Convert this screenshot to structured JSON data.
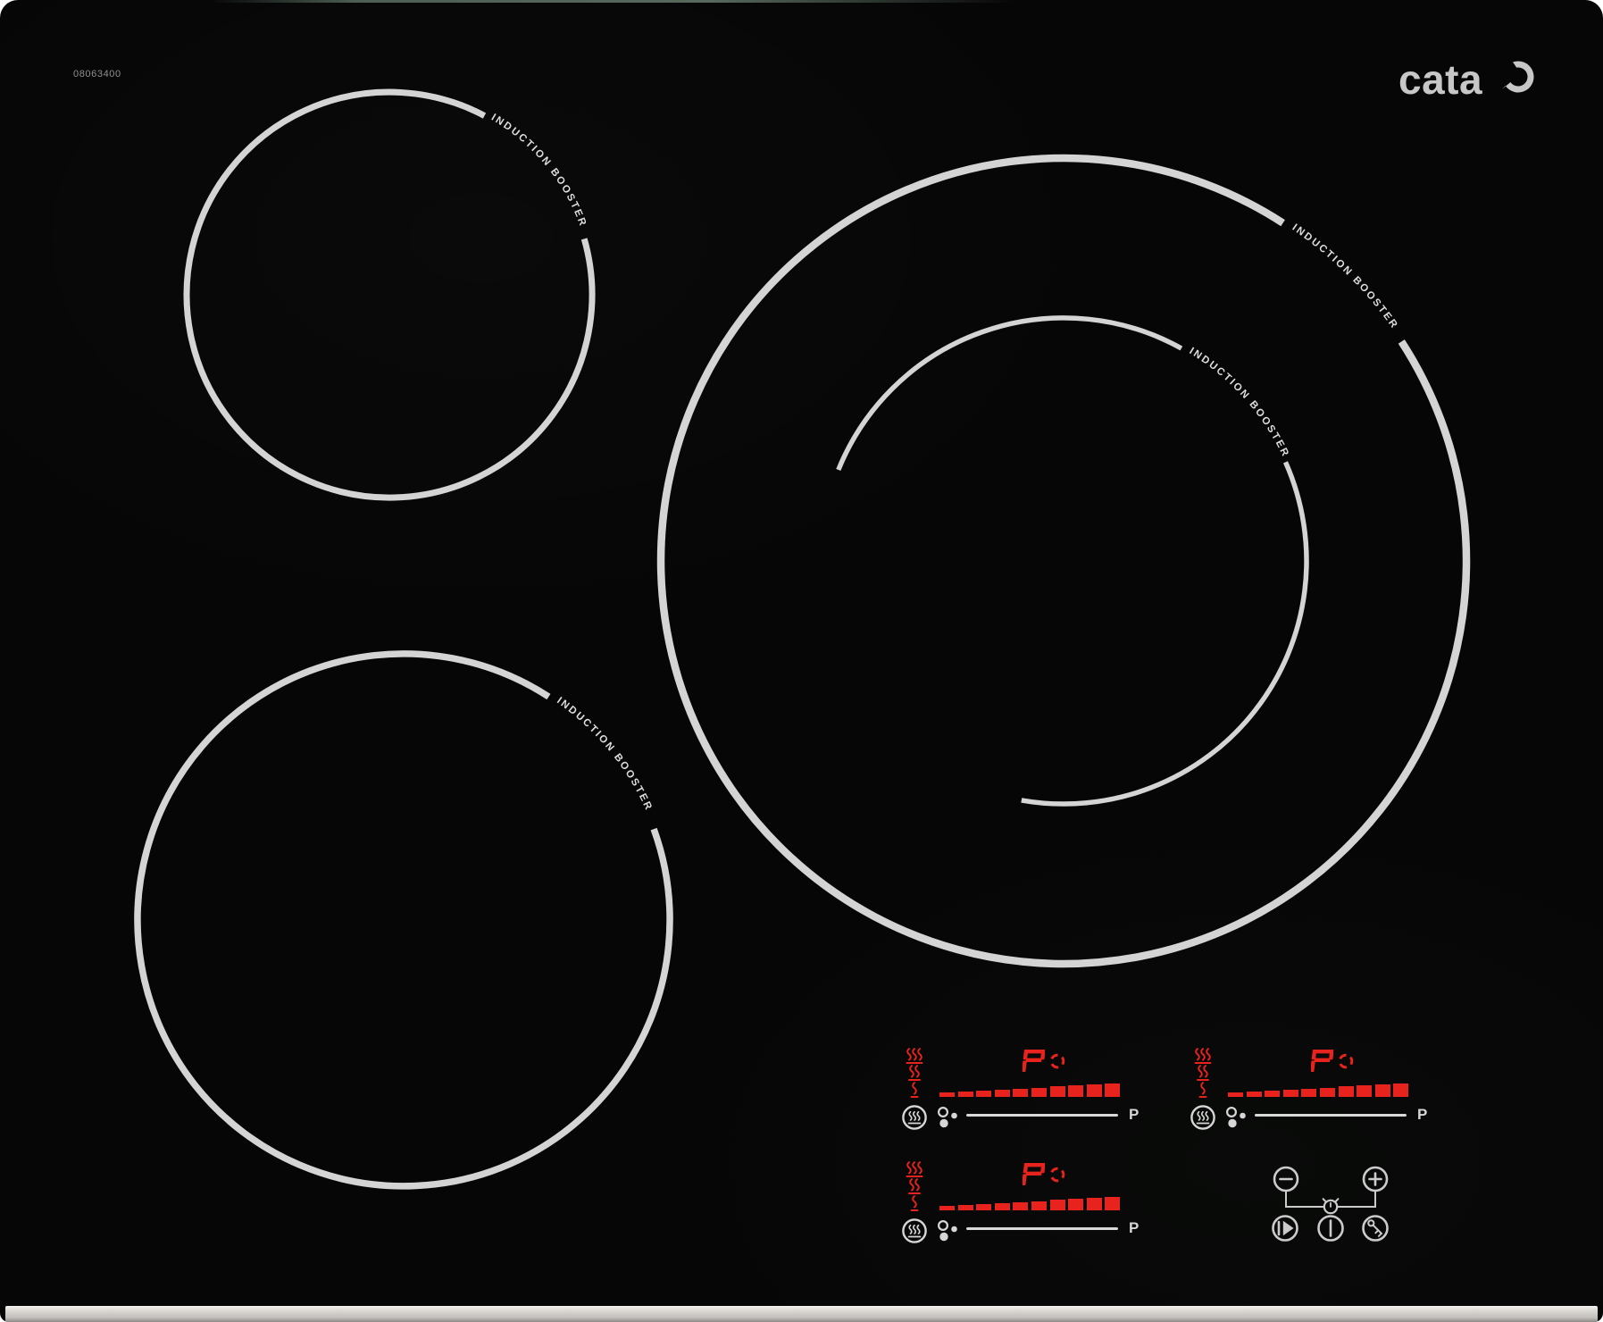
{
  "device": {
    "brand": "cata",
    "model_number": "08063400"
  },
  "zones": [
    {
      "id": "back-left",
      "label": "INDUCTION BOOSTER"
    },
    {
      "id": "front-left",
      "label": "INDUCTION BOOSTER"
    },
    {
      "id": "right-outer",
      "label": "INDUCTION BOOSTER"
    },
    {
      "id": "right-inner",
      "label": "INDUCTION BOOSTER"
    }
  ],
  "clusters": [
    {
      "id": "display-right",
      "power_display": "P",
      "max_power_label": "P"
    },
    {
      "id": "display-far-right",
      "power_display": "P",
      "max_power_label": "P"
    },
    {
      "id": "display-front",
      "power_display": "P",
      "max_power_label": "P"
    }
  ],
  "power_bar": {
    "segments": 10
  },
  "indicator_icons": {
    "residual_heat": [
      "steam-3-icon",
      "steam-2-icon",
      "steam-1-icon"
    ],
    "keep_warm": "hotplate-steam-icon",
    "pan_detection": "pan-dots-icon",
    "boost_indicator": "dashed-circle-icon"
  },
  "controls": {
    "minus": "minus-icon",
    "plus": "plus-icon",
    "timer": "timer-clock-icon",
    "pause_resume": "play-pause-icon",
    "power": "power-switch-icon",
    "child_lock": "key-lock-icon"
  },
  "colors": {
    "display_red": "#e8231d",
    "control_white": "#cbcbcb",
    "ring_gray": "#d4d4d4",
    "trim_silver": "#c9c6c2",
    "glass_black": "#060606"
  }
}
